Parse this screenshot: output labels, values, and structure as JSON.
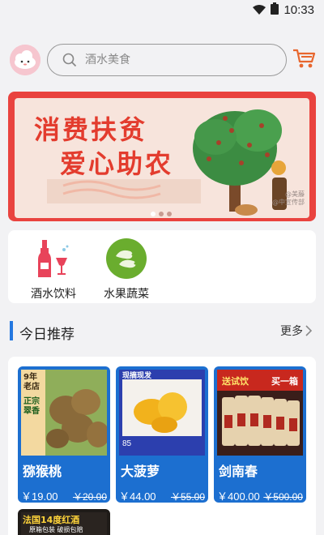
{
  "status": {
    "time": "10:33",
    "wifi_icon": "wifi-icon",
    "battery_icon": "battery-icon"
  },
  "header": {
    "avatar_icon": "cloud-face-avatar",
    "search_placeholder": "酒水美食",
    "cart_icon": "cart-icon"
  },
  "banner": {
    "line1": "消费扶贫",
    "line2": "爱心助农",
    "watermark_line1": "@美藤",
    "watermark_line2": "@中宣传部",
    "slide_count": 3,
    "active_slide": 1
  },
  "categories": [
    {
      "label": "酒水饮料",
      "icon": "wine-bottle-icon"
    },
    {
      "label": "水果蔬菜",
      "icon": "vegetable-icon"
    }
  ],
  "section": {
    "title": "今日推荐",
    "more": "更多"
  },
  "products": [
    {
      "name": "猕猴桃",
      "price": "￥19.00",
      "old_price": "￥20.00",
      "badge_lines": [
        "9年老店",
        "正宗翠香"
      ]
    },
    {
      "name": "大菠萝",
      "price": "￥44.00",
      "old_price": "￥55.00",
      "badge_top": "现摘现发",
      "badge_num": "85"
    },
    {
      "name": "剑南春",
      "price": "￥400.00",
      "old_price": "￥500.00",
      "badge_left": "送试饮",
      "badge_right": "买一箱"
    }
  ],
  "next_product": {
    "title": "法国14度红酒",
    "subtitle": "原箱包装 破损包赔"
  },
  "colors": {
    "accent": "#2478e0",
    "card_blue": "#1c6fd0",
    "banner_red": "#e9433f"
  }
}
